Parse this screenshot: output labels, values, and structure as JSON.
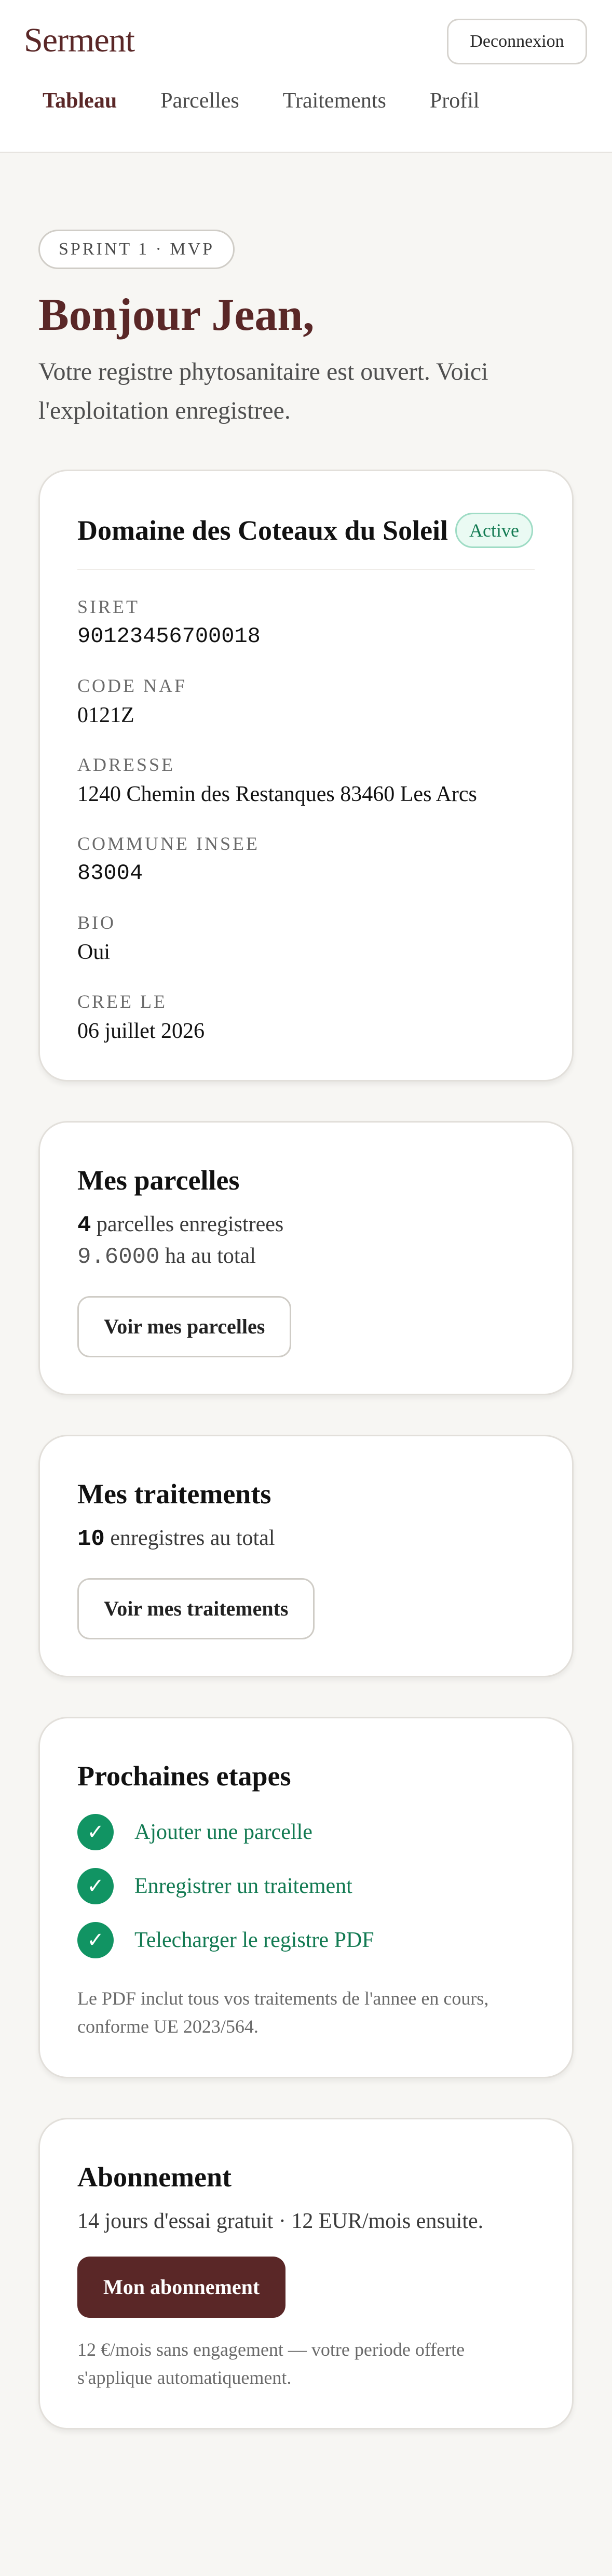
{
  "header": {
    "brand": "Serment",
    "logout_label": "Deconnexion",
    "nav": [
      {
        "label": "Tableau"
      },
      {
        "label": "Parcelles"
      },
      {
        "label": "Traitements"
      },
      {
        "label": "Profil"
      }
    ]
  },
  "hero": {
    "sprint": "SPRINT 1 · MVP",
    "greeting": "Bonjour Jean,",
    "intro": "Votre registre phytosanitaire est ouvert. Voici l'exploitation enregistree."
  },
  "farm": {
    "name": "Domaine des Coteaux du Soleil",
    "status": "Active",
    "fields": [
      {
        "label": "SIRET",
        "value": "90123456700018"
      },
      {
        "label": "CODE NAF",
        "value": "0121Z"
      },
      {
        "label": "ADRESSE",
        "value": "1240 Chemin des Restanques 83460 Les Arcs"
      },
      {
        "label": "COMMUNE INSEE",
        "value": "83004"
      },
      {
        "label": "BIO",
        "value": "Oui"
      },
      {
        "label": "CREE LE",
        "value": "06 juillet 2026"
      }
    ]
  },
  "parcels": {
    "title": "Mes parcelles",
    "count": "4",
    "count_text": " parcelles enregistrees",
    "area": "9.6000",
    "area_text": " ha au total",
    "button": "Voir mes parcelles"
  },
  "treatments": {
    "title": "Mes traitements",
    "count": "10",
    "count_text": " enregistres au total",
    "button": "Voir mes traitements"
  },
  "next_steps": {
    "title": "Prochaines etapes",
    "check_glyph": "✓",
    "steps": [
      {
        "label": "Ajouter une parcelle"
      },
      {
        "label": "Enregistrer un traitement"
      },
      {
        "label": "Telecharger le registre PDF"
      }
    ],
    "note": "Le PDF inclut tous vos traitements de l'annee en cours, conforme UE 2023/564."
  },
  "subscription": {
    "title": "Abonnement",
    "text": "14 jours d'essai gratuit · 12 EUR/mois ensuite.",
    "button": "Mon abonnement",
    "note": "12 €/mois sans engagement — votre periode offerte s'applique automatiquement."
  },
  "colors": {
    "brand": "#5a2727",
    "accent_green": "#119463",
    "background": "#f7f6f3"
  }
}
